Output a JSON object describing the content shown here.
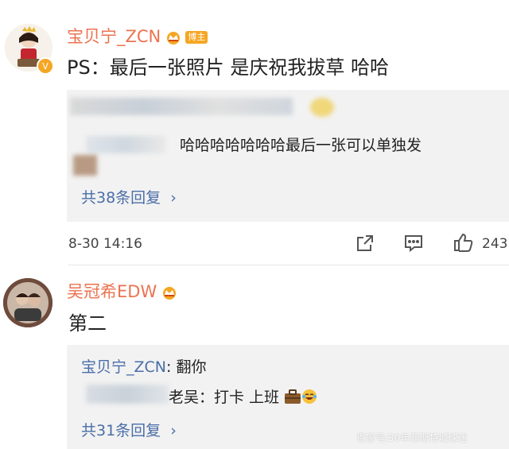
{
  "comments": [
    {
      "username": "宝贝宁_ZCN",
      "badge": "博主",
      "text": "PS：最后一张照片 是庆祝我拔草 哈哈",
      "reply_preview": {
        "text": "哈哈哈哈哈哈哈最后一张可以单独发",
        "more_label": "共38条回复",
        "chevron": "›"
      },
      "time": "8-30 14:16",
      "like_count": "243",
      "icons": [
        "share-icon",
        "comment-icon",
        "like-icon"
      ]
    },
    {
      "username": "吴冠希EDW",
      "text": "第二",
      "reply_preview": {
        "author": "宝贝宁_ZCN",
        "author_text": ": 翻你",
        "text": "老吴：打卡 上班",
        "more_label": "共31条回复",
        "chevron": "›"
      }
    }
  ],
  "colors": {
    "username": "#eb7350",
    "link": "#4a6ea8",
    "reply_bg": "#f2f2f2",
    "badge": "#f5a623"
  },
  "watermark": "百家号/30年菲斯特城球迷"
}
